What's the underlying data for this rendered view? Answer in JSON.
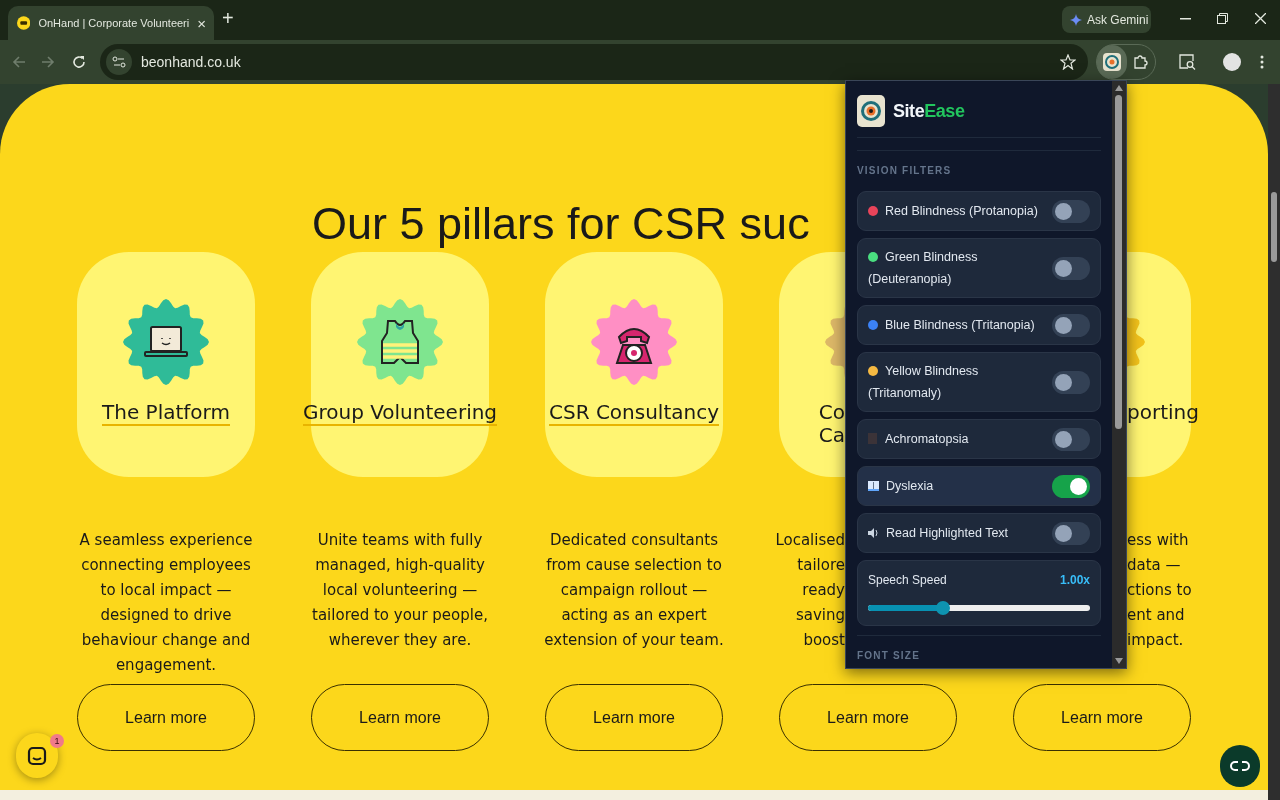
{
  "browser": {
    "tab": {
      "title": "OnHand | Corporate Volunteeri",
      "close": "×",
      "selected": true
    },
    "new_tab": "+",
    "address": "beonhand.co.uk",
    "gemini_button": "Ask Gemini"
  },
  "page": {
    "heading": "Our 5 pillars for CSR suc",
    "cards": [
      {
        "kind": "laptop",
        "color": "#2fbb98",
        "title": [
          "The Platform"
        ],
        "description": [
          "A seamless experience",
          "connecting employees",
          "to local impact —",
          "designed to drive",
          "behaviour change and",
          "engagement."
        ],
        "button": "Learn more"
      },
      {
        "kind": "vest",
        "color": "#7fe58f",
        "title": [
          "Group Volunteering"
        ],
        "description": [
          "Unite teams with fully",
          "managed, high-quality",
          "local volunteering —",
          "tailored to your people,",
          "wherever they are."
        ],
        "button": "Learn more"
      },
      {
        "kind": "phone",
        "color": "#ff8fc4",
        "title": [
          "CSR Consultancy"
        ],
        "description": [
          "Dedicated consultants",
          "from cause selection to",
          "campaign rollout —",
          "acting as an expert",
          "extension of your team."
        ],
        "button": "Learn more"
      },
      {
        "kind": "cut_right",
        "title": [
          "Co",
          "Ca"
        ],
        "description": [
          "Localised",
          "tailore",
          "ready",
          "saving",
          "boost"
        ],
        "button": "Learn more"
      },
      {
        "kind": "cut_left",
        "title": [
          "porting"
        ],
        "description": [
          "ess with",
          "data —",
          "ctions to",
          "ent and",
          "impact."
        ],
        "button": "Learn more"
      }
    ],
    "chat_badge": "1"
  },
  "extension": {
    "brand": "Site",
    "brand_accent": "Ease",
    "section": "VISION FILTERS",
    "options": [
      {
        "kind": "dot",
        "color": "#e8445a",
        "label": "Red Blindness (Protanopia)",
        "on": false
      },
      {
        "kind": "dot",
        "color": "#4ade80",
        "label": "Green Blindness (Deuteranopia)",
        "on": false
      },
      {
        "kind": "dot",
        "color": "#3b82f6",
        "label": "Blue Blindness (Tritanopia)",
        "on": false
      },
      {
        "kind": "dot",
        "color": "#f5b942",
        "label": "Yellow Blindness (Tritanomaly)",
        "on": false
      },
      {
        "kind": "square",
        "label": "Achromatopsia",
        "on": false
      },
      {
        "kind": "book",
        "label": "Dyslexia",
        "on": true
      },
      {
        "kind": "speaker",
        "label": "Read Highlighted Text",
        "on": false
      }
    ],
    "speech": {
      "label": "Speech Speed",
      "reading": "1.00x",
      "level": 0.34
    },
    "next_section": "FONT SIZE"
  }
}
